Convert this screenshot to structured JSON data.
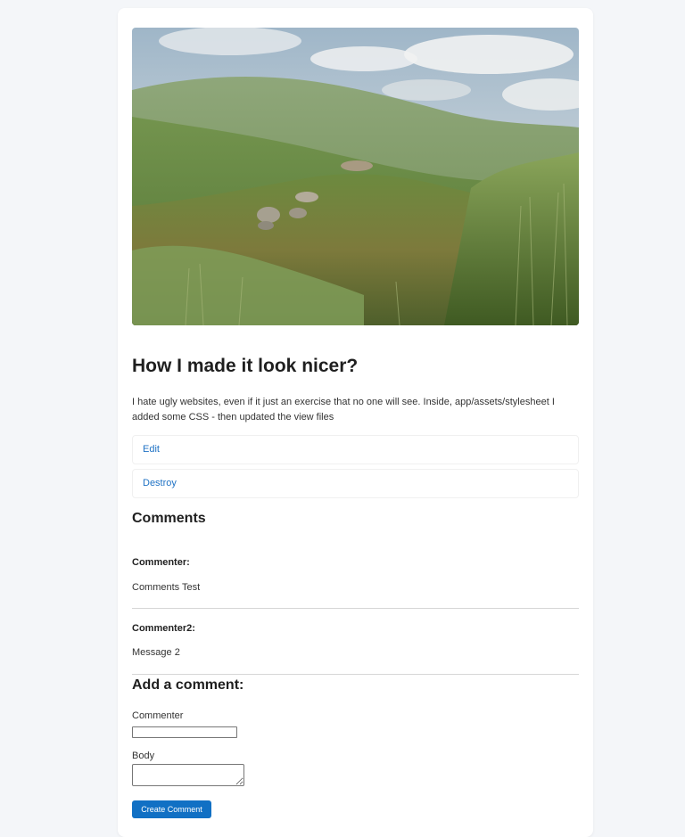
{
  "post": {
    "title": "How I made it look nicer?",
    "body": "I hate ugly websites, even if it just an exercise that no one will see. Inside, app/assets/stylesheet I added some CSS - then updated the view files",
    "image_icon": "landscape-photo"
  },
  "actions": {
    "edit_label": "Edit",
    "destroy_label": "Destroy"
  },
  "comments": {
    "heading": "Comments",
    "items": [
      {
        "commenter": "Commenter:",
        "body": "Comments Test"
      },
      {
        "commenter": "Commenter2:",
        "body": "Message 2"
      }
    ]
  },
  "form": {
    "heading": "Add a comment:",
    "commenter_label": "Commenter",
    "commenter_value": "",
    "body_label": "Body",
    "body_value": "",
    "submit_label": "Create Comment"
  },
  "colors": {
    "accent": "#1170c4",
    "link": "#1f72c4",
    "page_background": "#f4f6f9",
    "card_background": "#ffffff"
  }
}
